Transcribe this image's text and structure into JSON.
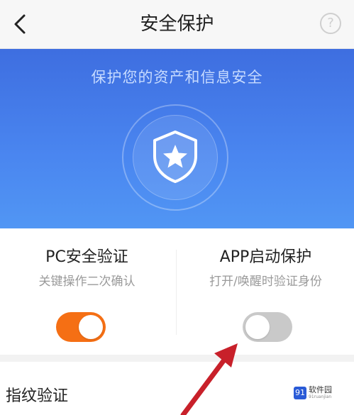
{
  "header": {
    "title": "安全保护",
    "back_icon": "chevron-left-icon",
    "help_glyph": "?"
  },
  "hero": {
    "tagline": "保护您的资产和信息安全",
    "emblem_icon": "shield-star-icon"
  },
  "cards": [
    {
      "title": "PC安全验证",
      "subtitle": "关键操作二次确认",
      "enabled": true
    },
    {
      "title": "APP启动保护",
      "subtitle": "打开/唤醒时验证身份",
      "enabled": false
    }
  ],
  "fingerprint": {
    "label": "指纹验证"
  },
  "watermark": {
    "logo": "91",
    "name": "软件园",
    "site": "91ruanjian"
  },
  "colors": {
    "accent_on": "#f56f14",
    "toggle_off": "#c9c9c9",
    "hero_blue": "#4a86f0"
  }
}
